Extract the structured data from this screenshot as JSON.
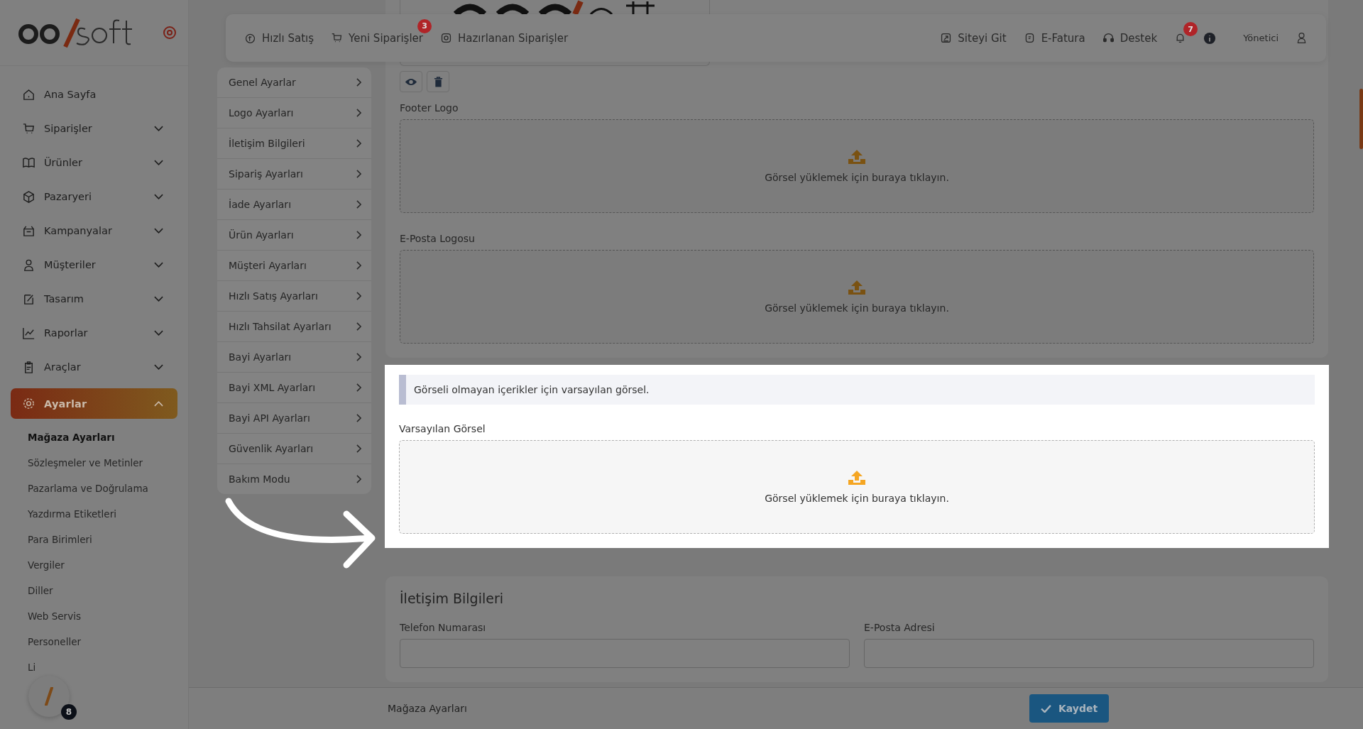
{
  "sidebar": {
    "menu": [
      {
        "label": "Ana Sayfa",
        "expandable": false,
        "expanded": false,
        "selected": false
      },
      {
        "label": "Siparişler",
        "expandable": true,
        "expanded": false,
        "selected": false
      },
      {
        "label": "Ürünler",
        "expandable": true,
        "expanded": false,
        "selected": false
      },
      {
        "label": "Pazaryeri",
        "expandable": true,
        "expanded": false,
        "selected": false
      },
      {
        "label": "Kampanyalar",
        "expandable": true,
        "expanded": false,
        "selected": false
      },
      {
        "label": "Müşteriler",
        "expandable": true,
        "expanded": false,
        "selected": false
      },
      {
        "label": "Tasarım",
        "expandable": true,
        "expanded": false,
        "selected": false
      },
      {
        "label": "Raporlar",
        "expandable": true,
        "expanded": false,
        "selected": false
      },
      {
        "label": "Araçlar",
        "expandable": true,
        "expanded": false,
        "selected": false
      },
      {
        "label": "Ayarlar",
        "expandable": true,
        "expanded": true,
        "selected": true
      }
    ],
    "submenu": [
      {
        "label": "Mağaza Ayarları",
        "selected": true
      },
      {
        "label": "Sözleşmeler ve Metinler",
        "selected": false
      },
      {
        "label": "Pazarlama ve Doğrulama",
        "selected": false
      },
      {
        "label": "Yazdırma Etiketleri",
        "selected": false
      },
      {
        "label": "Para Birimleri",
        "selected": false
      },
      {
        "label": "Vergiler",
        "selected": false
      },
      {
        "label": "Diller",
        "selected": false
      },
      {
        "label": "Web Servis",
        "selected": false
      },
      {
        "label": "Personeller",
        "selected": false
      },
      {
        "label": "Li",
        "selected": false
      }
    ],
    "widget_badge": "8"
  },
  "topbar": {
    "left_links": [
      {
        "label": "Hızlı Satış"
      },
      {
        "label": "Yeni Siparişler",
        "badge": "3"
      },
      {
        "label": "Hazırlanan Siparişler"
      }
    ],
    "right_links": [
      {
        "label": "Siteyi Git"
      },
      {
        "label": "E-Fatura"
      },
      {
        "label": "Destek"
      }
    ],
    "notification_badge": "7",
    "user": "Yönetici"
  },
  "settings_menu": [
    "Genel Ayarlar",
    "Logo Ayarları",
    "İletişim Bilgileri",
    "Sipariş Ayarları",
    "İade Ayarları",
    "Ürün Ayarları",
    "Müşteri Ayarları",
    "Hızlı Satış Ayarları",
    "Hızlı Tahsilat Ayarları",
    "Bayi Ayarları",
    "Bayi XML Ayarları",
    "Bayi API Ayarları",
    "Güvenlik Ayarları",
    "Bakım Modu"
  ],
  "logo_uploads": [
    {
      "label": "Footer Logo",
      "prompt": "Görsel yüklemek için buraya tıklayın."
    },
    {
      "label": "E-Posta Logosu",
      "prompt": "Görsel yüklemek için buraya tıklayın."
    }
  ],
  "default_image": {
    "info": "Görseli olmayan içerikler için varsayılan görsel.",
    "label": "Varsayılan Görsel",
    "prompt": "Görsel yüklemek için buraya tıklayın."
  },
  "contact": {
    "title": "İletişim Bilgileri",
    "fields": [
      {
        "label": "Telefon Numarası"
      },
      {
        "label": "E-Posta Adresi"
      }
    ]
  },
  "footer": {
    "breadcrumb": "Mağaza Ayarları",
    "save_button": "Kaydet"
  }
}
